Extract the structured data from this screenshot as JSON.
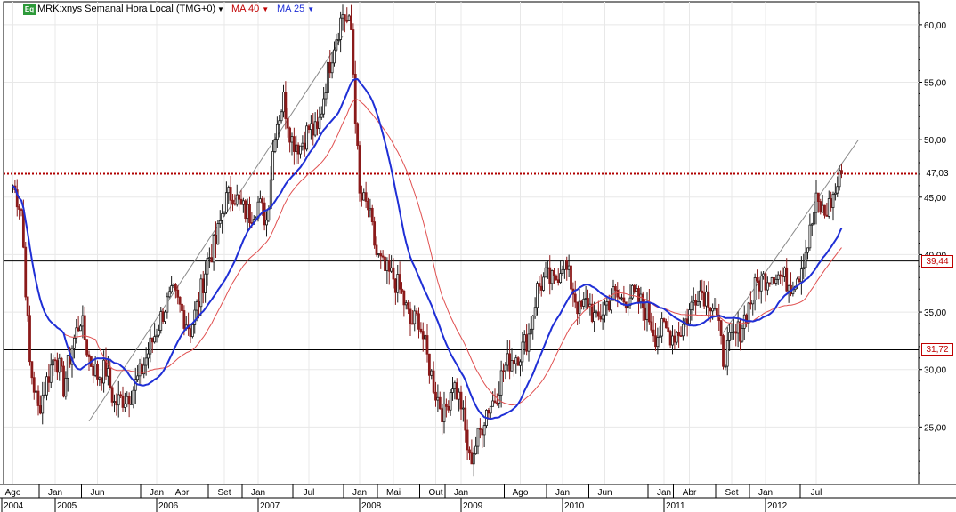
{
  "header": {
    "badge": "Eq",
    "symbol_title": "MRK:xnys Semanal Hora Local (TMG+0)",
    "ma40_label": "MA 40",
    "ma25_label": "MA 25"
  },
  "colors": {
    "up_candle": "#1a1a1a",
    "down_candle": "#8b1a1a",
    "ma25": "#1f2fd6",
    "ma40": "#e05050",
    "resistance_dotted": "#b00000",
    "ma40_text": "#c00000",
    "ma25_text": "#1f2fd6"
  },
  "chart_data": {
    "type": "candlestick",
    "title": "MRK:xnys Semanal Hora Local (TMG+0)",
    "ylim": [
      20,
      62
    ],
    "y_ticks": [
      "25,00",
      "30,00",
      "35,00",
      "40,00",
      "45,00",
      "50,00",
      "55,00",
      "60,00"
    ],
    "x_month_labels": [
      "Ago",
      "Jan",
      "Jun",
      "Jan",
      "Abr",
      "Set",
      "Jan",
      "Jul",
      "Jan",
      "Mai",
      "Out",
      "Jan",
      "Ago",
      "Jan",
      "Jun",
      "Jan",
      "Abr",
      "Set",
      "Jan",
      "Jul"
    ],
    "x_year_labels": [
      "2004",
      "2005",
      "2006",
      "2007",
      "2008",
      "2009",
      "2010",
      "2011",
      "2012"
    ],
    "horizontal_lines": [
      {
        "label": "47,03",
        "value": 47.03,
        "style": "dotted"
      },
      {
        "label": "39,44",
        "value": 39.44,
        "style": "solid"
      },
      {
        "label": "31,72",
        "value": 31.72,
        "style": "solid"
      }
    ],
    "trendlines": [
      {
        "from": [
          "2005-05",
          25.5
        ],
        "to": [
          "2007-11",
          59
        ]
      },
      {
        "from": [
          "2011-08",
          33.2
        ],
        "to": [
          "2012-12",
          50
        ]
      }
    ],
    "series": [
      {
        "name": "MA 40"
      },
      {
        "name": "MA 25"
      }
    ],
    "price_anchors": [
      [
        "2004-08",
        46.0
      ],
      [
        "2004-09",
        44.0
      ],
      [
        "2004-10",
        30.5
      ],
      [
        "2004-11",
        26.5
      ],
      [
        "2004-12",
        29.0
      ],
      [
        "2005-01",
        31.5
      ],
      [
        "2005-02",
        28.5
      ],
      [
        "2005-03",
        32.0
      ],
      [
        "2005-04",
        34.5
      ],
      [
        "2005-05",
        31.0
      ],
      [
        "2005-06",
        29.5
      ],
      [
        "2005-07",
        30.0
      ],
      [
        "2005-08",
        27.0
      ],
      [
        "2005-09",
        27.5
      ],
      [
        "2005-10",
        28.0
      ],
      [
        "2005-11",
        29.5
      ],
      [
        "2005-12",
        31.5
      ],
      [
        "2006-01",
        33.5
      ],
      [
        "2006-02",
        35.5
      ],
      [
        "2006-03",
        36.5
      ],
      [
        "2006-04",
        35.0
      ],
      [
        "2006-05",
        33.5
      ],
      [
        "2006-06",
        36.0
      ],
      [
        "2006-07",
        39.5
      ],
      [
        "2006-08",
        41.0
      ],
      [
        "2006-09",
        44.5
      ],
      [
        "2006-10",
        45.5
      ],
      [
        "2006-11",
        44.0
      ],
      [
        "2006-12",
        43.5
      ],
      [
        "2007-01",
        44.5
      ],
      [
        "2007-02",
        43.0
      ],
      [
        "2007-03",
        51.0
      ],
      [
        "2007-04",
        53.5
      ],
      [
        "2007-05",
        50.0
      ],
      [
        "2007-06",
        49.5
      ],
      [
        "2007-07",
        51.0
      ],
      [
        "2007-08",
        50.5
      ],
      [
        "2007-09",
        55.0
      ],
      [
        "2007-10",
        58.5
      ],
      [
        "2007-11",
        61.0
      ],
      [
        "2007-12",
        59.5
      ],
      [
        "2008-01",
        45.0
      ],
      [
        "2008-02",
        44.0
      ],
      [
        "2008-03",
        40.0
      ],
      [
        "2008-04",
        38.5
      ],
      [
        "2008-05",
        38.0
      ],
      [
        "2008-06",
        36.5
      ],
      [
        "2008-07",
        34.0
      ],
      [
        "2008-08",
        34.5
      ],
      [
        "2008-09",
        31.0
      ],
      [
        "2008-10",
        28.0
      ],
      [
        "2008-11",
        26.0
      ],
      [
        "2008-12",
        29.0
      ],
      [
        "2009-01",
        27.0
      ],
      [
        "2009-02",
        22.0
      ],
      [
        "2009-03",
        24.0
      ],
      [
        "2009-04",
        26.5
      ],
      [
        "2009-05",
        27.5
      ],
      [
        "2009-06",
        30.0
      ],
      [
        "2009-07",
        31.0
      ],
      [
        "2009-08",
        31.5
      ],
      [
        "2009-09",
        33.0
      ],
      [
        "2009-10",
        37.0
      ],
      [
        "2009-11",
        38.0
      ],
      [
        "2009-12",
        37.5
      ],
      [
        "2010-01",
        39.5
      ],
      [
        "2010-02",
        37.5
      ],
      [
        "2010-03",
        35.0
      ],
      [
        "2010-04",
        36.0
      ],
      [
        "2010-05",
        34.0
      ],
      [
        "2010-06",
        35.5
      ],
      [
        "2010-07",
        36.5
      ],
      [
        "2010-08",
        36.0
      ],
      [
        "2010-09",
        36.5
      ],
      [
        "2010-10",
        36.0
      ],
      [
        "2010-11",
        35.0
      ],
      [
        "2010-12",
        33.0
      ],
      [
        "2011-01",
        33.5
      ],
      [
        "2011-02",
        33.0
      ],
      [
        "2011-03",
        33.5
      ],
      [
        "2011-04",
        35.0
      ],
      [
        "2011-05",
        37.0
      ],
      [
        "2011-06",
        36.5
      ],
      [
        "2011-07",
        35.5
      ],
      [
        "2011-08",
        31.0
      ],
      [
        "2011-09",
        32.5
      ],
      [
        "2011-10",
        33.5
      ],
      [
        "2011-11",
        35.5
      ],
      [
        "2011-12",
        37.5
      ],
      [
        "2012-01",
        38.0
      ],
      [
        "2012-02",
        38.5
      ],
      [
        "2012-03",
        38.0
      ],
      [
        "2012-04",
        37.5
      ],
      [
        "2012-05",
        38.5
      ],
      [
        "2012-06",
        41.0
      ],
      [
        "2012-07",
        44.5
      ],
      [
        "2012-08",
        43.5
      ],
      [
        "2012-09",
        45.0
      ],
      [
        "2012-10",
        47.03
      ]
    ]
  }
}
